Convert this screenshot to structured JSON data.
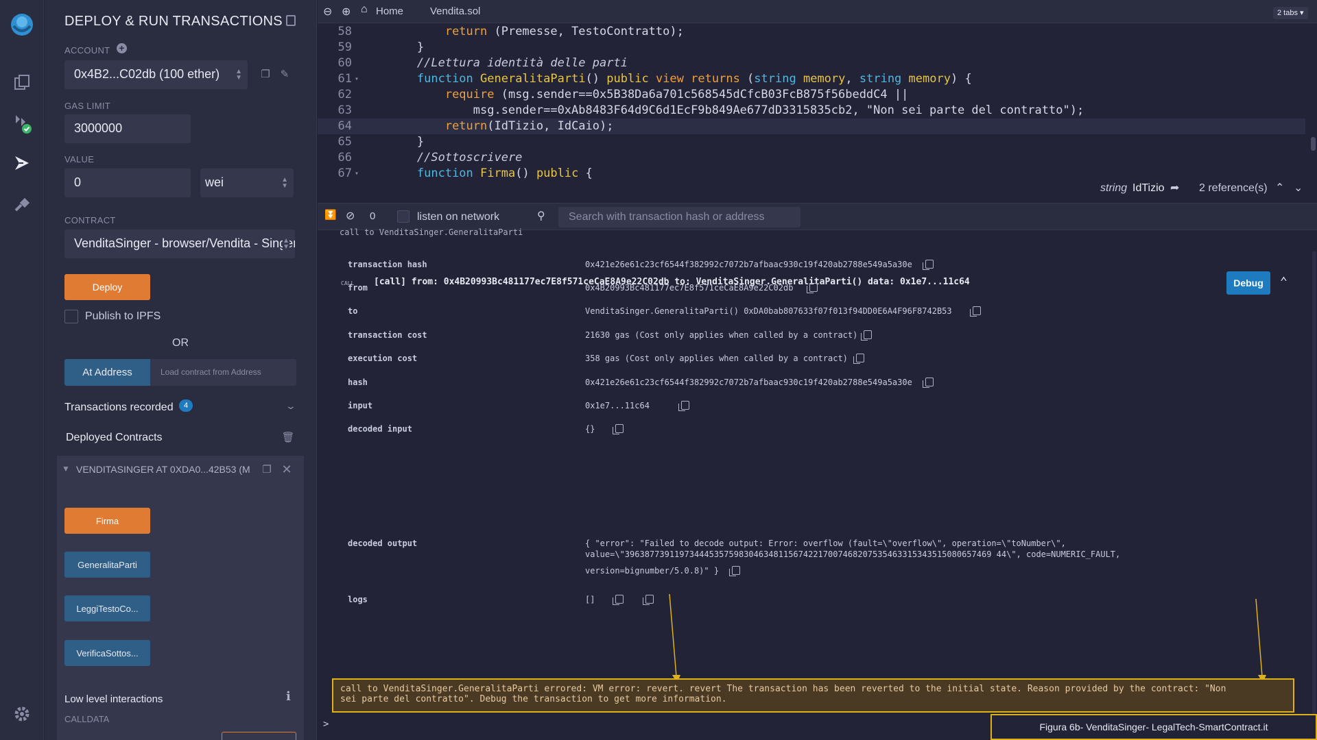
{
  "icon_rail": {
    "icons": [
      "remix-logo-icon",
      "file-explorer-icon",
      "compiler-icon",
      "deploy-run-icon",
      "plugin-manager-icon",
      "settings-icon"
    ]
  },
  "panel": {
    "title": "DEPLOY & RUN TRANSACTIONS",
    "account_label": "ACCOUNT",
    "account_value": "0x4B2...C02db (100 ether)",
    "gas_limit_label": "GAS LIMIT",
    "gas_limit_value": "3000000",
    "value_label": "VALUE",
    "value_amount": "0",
    "value_unit": "wei",
    "contract_label": "CONTRACT",
    "contract_value": "VenditaSinger - browser/Vendita - Singer",
    "deploy_label": "Deploy",
    "publish_ipfs_label": "Publish to IPFS",
    "or_label": "OR",
    "at_address_label": "At Address",
    "load_contract_placeholder": "Load contract from Address",
    "transactions_recorded_label": "Transactions recorded",
    "transactions_recorded_count": "4",
    "deployed_contracts_label": "Deployed Contracts",
    "deployed_instance_label": "VENDITASINGER AT 0XDA0...42B53 (M",
    "functions": [
      {
        "label": "Firma",
        "color": "orange"
      },
      {
        "label": "GeneralitaParti",
        "color": "blue"
      },
      {
        "label": "LeggiTestoCo...",
        "color": "blue"
      },
      {
        "label": "VerificaSottos...",
        "color": "blue"
      }
    ],
    "low_level_label": "Low level interactions",
    "calldata_label": "CALLDATA"
  },
  "editor": {
    "tabs": [
      {
        "label": "Home"
      },
      {
        "label": "Vendita.sol"
      }
    ],
    "tabs_count_label": "2 tabs",
    "lines": [
      {
        "n": "58",
        "fold": "",
        "segments": [
          {
            "t": "            ",
            "c": ""
          },
          {
            "t": "return",
            "c": "kw"
          },
          {
            "t": " (Premesse, TestoContratto);",
            "c": ""
          }
        ]
      },
      {
        "n": "59",
        "fold": "",
        "segments": [
          {
            "t": "        }",
            "c": ""
          }
        ]
      },
      {
        "n": "60",
        "fold": "",
        "segments": [
          {
            "t": "        ",
            "c": ""
          },
          {
            "t": "//Lettura identità delle parti",
            "c": "cm"
          }
        ]
      },
      {
        "n": "61",
        "fold": "▾",
        "segments": [
          {
            "t": "        ",
            "c": ""
          },
          {
            "t": "function",
            "c": "ty"
          },
          {
            "t": " ",
            "c": ""
          },
          {
            "t": "GeneralitaParti",
            "c": "fn"
          },
          {
            "t": "() ",
            "c": ""
          },
          {
            "t": "public",
            "c": "fn"
          },
          {
            "t": " ",
            "c": ""
          },
          {
            "t": "view",
            "c": "kw"
          },
          {
            "t": " ",
            "c": ""
          },
          {
            "t": "returns",
            "c": "kw"
          },
          {
            "t": " (",
            "c": ""
          },
          {
            "t": "string",
            "c": "ty"
          },
          {
            "t": " ",
            "c": ""
          },
          {
            "t": "memory",
            "c": "fn"
          },
          {
            "t": ", ",
            "c": ""
          },
          {
            "t": "string",
            "c": "ty"
          },
          {
            "t": " ",
            "c": ""
          },
          {
            "t": "memory",
            "c": "fn"
          },
          {
            "t": ") {",
            "c": ""
          }
        ]
      },
      {
        "n": "62",
        "fold": "",
        "segments": [
          {
            "t": "            ",
            "c": ""
          },
          {
            "t": "require",
            "c": "kw"
          },
          {
            "t": " (msg.sender==0x5B38Da6a701c568545dCfcB03FcB875f56beddC4 ||",
            "c": ""
          }
        ]
      },
      {
        "n": "63",
        "fold": "",
        "segments": [
          {
            "t": "                msg.sender==0xAb8483F64d9C6d1EcF9b849Ae677dD3315835cb2, \"Non sei parte del contratto\");",
            "c": ""
          }
        ]
      },
      {
        "n": "64",
        "fold": "",
        "segments": [
          {
            "t": "            ",
            "c": ""
          },
          {
            "t": "return",
            "c": "kw"
          },
          {
            "t": "(IdTizio, IdCaio);",
            "c": ""
          }
        ]
      },
      {
        "n": "65",
        "fold": "",
        "segments": [
          {
            "t": "        }",
            "c": ""
          }
        ]
      },
      {
        "n": "66",
        "fold": "",
        "segments": [
          {
            "t": "        ",
            "c": ""
          },
          {
            "t": "//Sottoscrivere",
            "c": "cm"
          }
        ]
      },
      {
        "n": "67",
        "fold": "▾",
        "segments": [
          {
            "t": "        ",
            "c": ""
          },
          {
            "t": "function",
            "c": "ty"
          },
          {
            "t": " ",
            "c": ""
          },
          {
            "t": "Firma",
            "c": "fn"
          },
          {
            "t": "() ",
            "c": ""
          },
          {
            "t": "public",
            "c": "fn"
          },
          {
            "t": " {",
            "c": ""
          }
        ]
      }
    ],
    "status_type": "string",
    "status_name": "IdTizio",
    "references_label": "2 reference(s)"
  },
  "terminal": {
    "pending_count": "0",
    "listen_label": "listen on network",
    "search_placeholder": "Search with transaction hash or address",
    "previous_line": "call to VenditaSinger.GeneralitaParti",
    "call_tag": "CALL",
    "call_summary": "[call]  from: 0x4B20993Bc481177ec7E8f571ceCaE8A9e22C02db to: VenditaSinger.GeneralitaParti() data: 0x1e7...11c64",
    "debug_label": "Debug",
    "rows": [
      {
        "key": "transaction hash",
        "value": "0x421e26e61c23cf6544f382992c7072b7afbaac930c19f420ab2788e549a5a30e"
      },
      {
        "key": "from",
        "value": "0x4B20993Bc481177ec7E8f571ceCaE8A9e22C02db"
      },
      {
        "key": "to",
        "value": "VenditaSinger.GeneralitaParti() 0xDA0bab807633f07f013f94DD0E6A4F96F8742B53"
      },
      {
        "key": "transaction cost",
        "value": "21630 gas (Cost only applies when called by a contract)"
      },
      {
        "key": "execution cost",
        "value": "358 gas (Cost only applies when called by a contract)"
      },
      {
        "key": "hash",
        "value": "0x421e26e61c23cf6544f382992c7072b7afbaac930c19f420ab2788e549a5a30e"
      },
      {
        "key": "input",
        "value": "0x1e7...11c64"
      },
      {
        "key": "decoded input",
        "value": "{}"
      }
    ],
    "decoded_output_key": "decoded output",
    "decoded_output_line1": "{ \"error\": \"Failed to decode output: Error: overflow (fault=\\\"overflow\\\", operation=\\\"toNumber\\\",",
    "decoded_output_line2": "value=\\\"39638773911973444535759830463481156742217007468207535463315343515080657469 44\\\", code=NUMERIC_FAULT,",
    "decoded_output_line3": "version=bignumber/5.0.8)\" }",
    "logs_key": "logs",
    "logs_value": "[]",
    "error_line1": "call to VenditaSinger.GeneralitaParti errored: VM error: revert. revert The transaction has been reverted to the initial state. Reason provided by the contract: \"Non",
    "error_line2": "sei parte del contratto\". Debug the transaction to get more information.",
    "prompt": ">"
  },
  "caption": "Figura 6b- VenditaSinger- LegalTech-SmartContract.it",
  "colors": {
    "background": "#222336",
    "panel": "#2a2c3f",
    "orange_button": "#e07b34",
    "blue_button": "#2f5f86",
    "debug_button": "#1e7bc0",
    "annotation": "#e0b21a"
  }
}
